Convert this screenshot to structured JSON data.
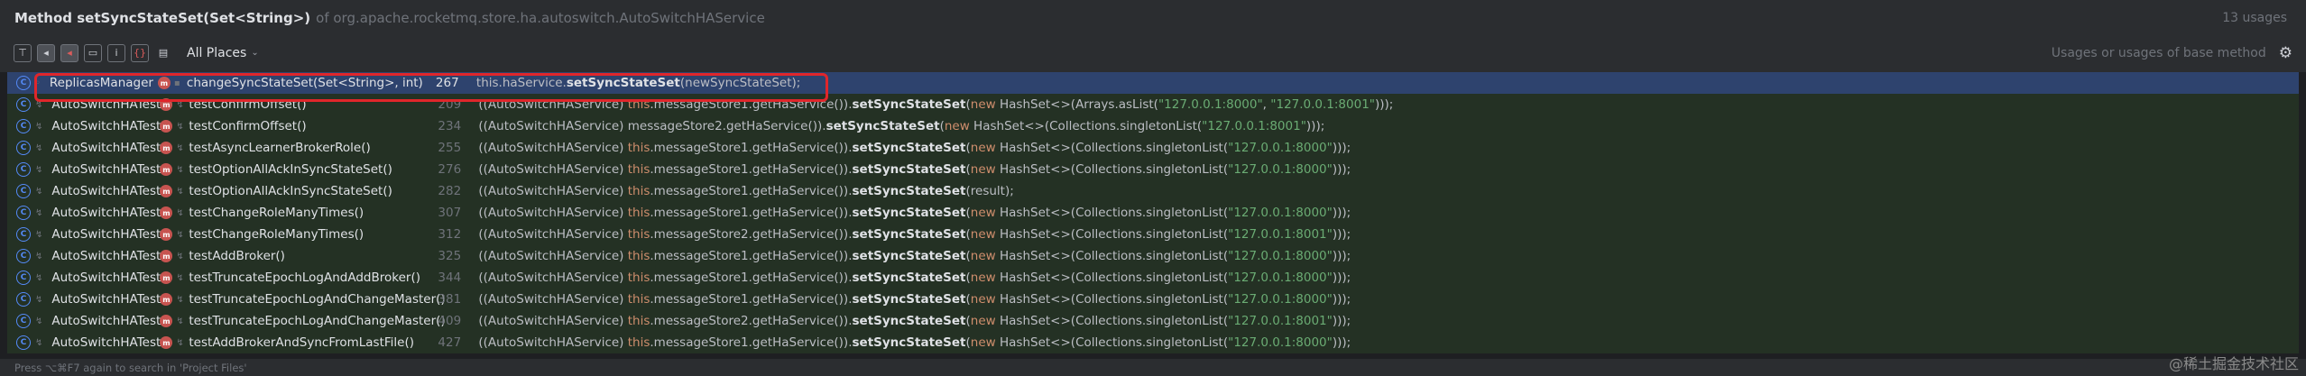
{
  "header": {
    "title": "Method setSyncStateSet(Set<String>)",
    "location": "of org.apache.rocketmq.store.ha.autoswitch.AutoSwitchHAService",
    "usages": "13 usages"
  },
  "toolbar": {
    "scope_label": "All Places",
    "right_label": "Usages or usages of base method"
  },
  "rows": [
    {
      "cls": "ReplicasManager",
      "method": "changeSyncStateSet(Set<String>, int)",
      "line": "267",
      "code": [
        {
          "t": "this.haService.",
          "c": "plain"
        },
        {
          "t": "setSyncStateSet",
          "c": "bold"
        },
        {
          "t": "(newSyncStateSet);",
          "c": "plain"
        }
      ]
    },
    {
      "cls": "AutoSwitchHATest",
      "method": "testConfirmOffset()",
      "line": "209",
      "code": [
        {
          "t": "((AutoSwitchHAService) ",
          "c": "plain"
        },
        {
          "t": "this",
          "c": "kw"
        },
        {
          "t": ".messageStore1.getHaService()).",
          "c": "plain"
        },
        {
          "t": "setSyncStateSet",
          "c": "bold"
        },
        {
          "t": "(",
          "c": "plain"
        },
        {
          "t": "new",
          "c": "kw"
        },
        {
          "t": " HashSet<>(Arrays.asList(",
          "c": "plain"
        },
        {
          "t": "\"127.0.0.1:8000\"",
          "c": "str"
        },
        {
          "t": ", ",
          "c": "plain"
        },
        {
          "t": "\"127.0.0.1:8001\"",
          "c": "str"
        },
        {
          "t": ")));",
          "c": "plain"
        }
      ]
    },
    {
      "cls": "AutoSwitchHATest",
      "method": "testConfirmOffset()",
      "line": "234",
      "code": [
        {
          "t": "((AutoSwitchHAService) messageStore2.getHaService()).",
          "c": "plain"
        },
        {
          "t": "setSyncStateSet",
          "c": "bold"
        },
        {
          "t": "(",
          "c": "plain"
        },
        {
          "t": "new",
          "c": "kw"
        },
        {
          "t": " HashSet<>(Collections.singletonList(",
          "c": "plain"
        },
        {
          "t": "\"127.0.0.1:8001\"",
          "c": "str"
        },
        {
          "t": ")));",
          "c": "plain"
        }
      ]
    },
    {
      "cls": "AutoSwitchHATest",
      "method": "testAsyncLearnerBrokerRole()",
      "line": "255",
      "code": [
        {
          "t": "((AutoSwitchHAService) ",
          "c": "plain"
        },
        {
          "t": "this",
          "c": "kw"
        },
        {
          "t": ".messageStore1.getHaService()).",
          "c": "plain"
        },
        {
          "t": "setSyncStateSet",
          "c": "bold"
        },
        {
          "t": "(",
          "c": "plain"
        },
        {
          "t": "new",
          "c": "kw"
        },
        {
          "t": " HashSet<>(Collections.singletonList(",
          "c": "plain"
        },
        {
          "t": "\"127.0.0.1:8000\"",
          "c": "str"
        },
        {
          "t": ")));",
          "c": "plain"
        }
      ]
    },
    {
      "cls": "AutoSwitchHATest",
      "method": "testOptionAllAckInSyncStateSet()",
      "line": "276",
      "code": [
        {
          "t": "((AutoSwitchHAService) ",
          "c": "plain"
        },
        {
          "t": "this",
          "c": "kw"
        },
        {
          "t": ".messageStore1.getHaService()).",
          "c": "plain"
        },
        {
          "t": "setSyncStateSet",
          "c": "bold"
        },
        {
          "t": "(",
          "c": "plain"
        },
        {
          "t": "new",
          "c": "kw"
        },
        {
          "t": " HashSet<>(Collections.singletonList(",
          "c": "plain"
        },
        {
          "t": "\"127.0.0.1:8000\"",
          "c": "str"
        },
        {
          "t": ")));",
          "c": "plain"
        }
      ]
    },
    {
      "cls": "AutoSwitchHATest",
      "method": "testOptionAllAckInSyncStateSet()",
      "line": "282",
      "code": [
        {
          "t": "((AutoSwitchHAService) ",
          "c": "plain"
        },
        {
          "t": "this",
          "c": "kw"
        },
        {
          "t": ".messageStore1.getHaService()).",
          "c": "plain"
        },
        {
          "t": "setSyncStateSet",
          "c": "bold"
        },
        {
          "t": "(result);",
          "c": "plain"
        }
      ]
    },
    {
      "cls": "AutoSwitchHATest",
      "method": "testChangeRoleManyTimes()",
      "line": "307",
      "code": [
        {
          "t": "((AutoSwitchHAService) ",
          "c": "plain"
        },
        {
          "t": "this",
          "c": "kw"
        },
        {
          "t": ".messageStore1.getHaService()).",
          "c": "plain"
        },
        {
          "t": "setSyncStateSet",
          "c": "bold"
        },
        {
          "t": "(",
          "c": "plain"
        },
        {
          "t": "new",
          "c": "kw"
        },
        {
          "t": " HashSet<>(Collections.singletonList(",
          "c": "plain"
        },
        {
          "t": "\"127.0.0.1:8000\"",
          "c": "str"
        },
        {
          "t": ")));",
          "c": "plain"
        }
      ]
    },
    {
      "cls": "AutoSwitchHATest",
      "method": "testChangeRoleManyTimes()",
      "line": "312",
      "code": [
        {
          "t": "((AutoSwitchHAService) ",
          "c": "plain"
        },
        {
          "t": "this",
          "c": "kw"
        },
        {
          "t": ".messageStore2.getHaService()).",
          "c": "plain"
        },
        {
          "t": "setSyncStateSet",
          "c": "bold"
        },
        {
          "t": "(",
          "c": "plain"
        },
        {
          "t": "new",
          "c": "kw"
        },
        {
          "t": " HashSet<>(Collections.singletonList(",
          "c": "plain"
        },
        {
          "t": "\"127.0.0.1:8001\"",
          "c": "str"
        },
        {
          "t": ")));",
          "c": "plain"
        }
      ]
    },
    {
      "cls": "AutoSwitchHATest",
      "method": "testAddBroker()",
      "line": "325",
      "code": [
        {
          "t": "((AutoSwitchHAService) ",
          "c": "plain"
        },
        {
          "t": "this",
          "c": "kw"
        },
        {
          "t": ".messageStore1.getHaService()).",
          "c": "plain"
        },
        {
          "t": "setSyncStateSet",
          "c": "bold"
        },
        {
          "t": "(",
          "c": "plain"
        },
        {
          "t": "new",
          "c": "kw"
        },
        {
          "t": " HashSet<>(Collections.singletonList(",
          "c": "plain"
        },
        {
          "t": "\"127.0.0.1:8000\"",
          "c": "str"
        },
        {
          "t": ")));",
          "c": "plain"
        }
      ]
    },
    {
      "cls": "AutoSwitchHATest",
      "method": "testTruncateEpochLogAndAddBroker()",
      "line": "344",
      "code": [
        {
          "t": "((AutoSwitchHAService) ",
          "c": "plain"
        },
        {
          "t": "this",
          "c": "kw"
        },
        {
          "t": ".messageStore1.getHaService()).",
          "c": "plain"
        },
        {
          "t": "setSyncStateSet",
          "c": "bold"
        },
        {
          "t": "(",
          "c": "plain"
        },
        {
          "t": "new",
          "c": "kw"
        },
        {
          "t": " HashSet<>(Collections.singletonList(",
          "c": "plain"
        },
        {
          "t": "\"127.0.0.1:8000\"",
          "c": "str"
        },
        {
          "t": ")));",
          "c": "plain"
        }
      ]
    },
    {
      "cls": "AutoSwitchHATest",
      "method": "testTruncateEpochLogAndChangeMaster()",
      "line": "381",
      "code": [
        {
          "t": "((AutoSwitchHAService) ",
          "c": "plain"
        },
        {
          "t": "this",
          "c": "kw"
        },
        {
          "t": ".messageStore1.getHaService()).",
          "c": "plain"
        },
        {
          "t": "setSyncStateSet",
          "c": "bold"
        },
        {
          "t": "(",
          "c": "plain"
        },
        {
          "t": "new",
          "c": "kw"
        },
        {
          "t": " HashSet<>(Collections.singletonList(",
          "c": "plain"
        },
        {
          "t": "\"127.0.0.1:8000\"",
          "c": "str"
        },
        {
          "t": ")));",
          "c": "plain"
        }
      ]
    },
    {
      "cls": "AutoSwitchHATest",
      "method": "testTruncateEpochLogAndChangeMaster()",
      "line": "409",
      "code": [
        {
          "t": "((AutoSwitchHAService) ",
          "c": "plain"
        },
        {
          "t": "this",
          "c": "kw"
        },
        {
          "t": ".messageStore2.getHaService()).",
          "c": "plain"
        },
        {
          "t": "setSyncStateSet",
          "c": "bold"
        },
        {
          "t": "(",
          "c": "plain"
        },
        {
          "t": "new",
          "c": "kw"
        },
        {
          "t": " HashSet<>(Collections.singletonList(",
          "c": "plain"
        },
        {
          "t": "\"127.0.0.1:8001\"",
          "c": "str"
        },
        {
          "t": ")));",
          "c": "plain"
        }
      ]
    },
    {
      "cls": "AutoSwitchHATest",
      "method": "testAddBrokerAndSyncFromLastFile()",
      "line": "427",
      "code": [
        {
          "t": "((AutoSwitchHAService) ",
          "c": "plain"
        },
        {
          "t": "this",
          "c": "kw"
        },
        {
          "t": ".messageStore1.getHaService()).",
          "c": "plain"
        },
        {
          "t": "setSyncStateSet",
          "c": "bold"
        },
        {
          "t": "(",
          "c": "plain"
        },
        {
          "t": "new",
          "c": "kw"
        },
        {
          "t": " HashSet<>(Collections.singletonList(",
          "c": "plain"
        },
        {
          "t": "\"127.0.0.1:8000\"",
          "c": "str"
        },
        {
          "t": ")));",
          "c": "plain"
        }
      ]
    }
  ],
  "status": {
    "text": "Press ⌥⌘F7 again to search in 'Project Files'",
    "watermark": "@稀土掘金技术社区"
  }
}
